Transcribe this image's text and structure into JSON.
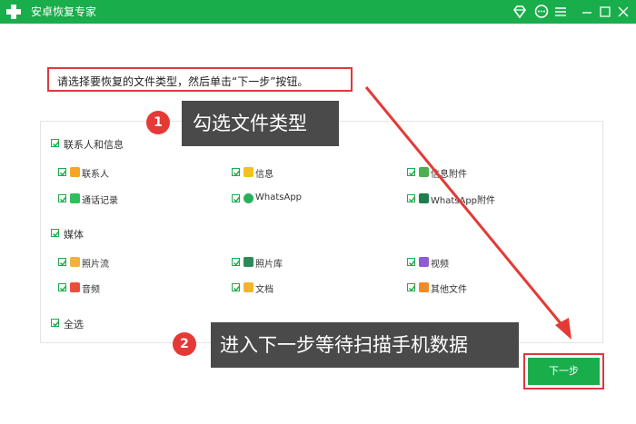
{
  "app": {
    "title": "安卓恢复专家"
  },
  "instruction": "请选择要恢复的文件类型，然后单击“下一步”按钮。",
  "groups": {
    "contacts": {
      "label": "联系人和信息",
      "items": [
        {
          "label": "联系人",
          "icon": "contact-card-icon",
          "color": "#f5a623"
        },
        {
          "label": "信息",
          "icon": "message-icon",
          "color": "#f2c31d"
        },
        {
          "label": "信息附件",
          "icon": "attachment-icon",
          "color": "#4caf50"
        },
        {
          "label": "通话记录",
          "icon": "phone-icon",
          "color": "#2fbf5d"
        },
        {
          "label": "WhatsApp",
          "icon": "whatsapp-icon",
          "color": "#25b15a"
        },
        {
          "label": "WhatsApp附件",
          "icon": "whatsapp-attachment-icon",
          "color": "#1e7d4a"
        }
      ]
    },
    "media": {
      "label": "媒体",
      "items": [
        {
          "label": "照片流",
          "icon": "photo-stream-icon",
          "color": "#f0b23a"
        },
        {
          "label": "照片库",
          "icon": "photo-library-icon",
          "color": "#2e8b57"
        },
        {
          "label": "视频",
          "icon": "video-icon",
          "color": "#8e5bd6"
        },
        {
          "label": "音频",
          "icon": "audio-icon",
          "color": "#e94e3c"
        },
        {
          "label": "文档",
          "icon": "folder-icon",
          "color": "#f3b431"
        },
        {
          "label": "其他文件",
          "icon": "other-file-icon",
          "color": "#f08a24"
        }
      ]
    }
  },
  "select_all": "全选",
  "callouts": [
    {
      "number": "1",
      "text": "勾选文件类型"
    },
    {
      "number": "2",
      "text": "进入下一步等待扫描手机数据"
    }
  ],
  "next_button": "下一步",
  "colors": {
    "brand": "#1aad4b",
    "highlight": "#e0393e",
    "callout_bg": "#4a4a4a"
  }
}
